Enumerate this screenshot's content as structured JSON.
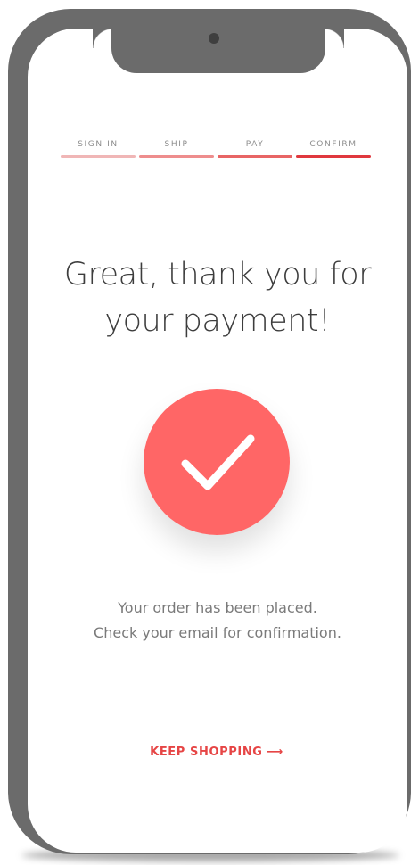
{
  "colors": {
    "accent": "#e64545",
    "check_fill": "#ff6666",
    "step_bars": [
      "#f0b6b6",
      "#ee8d8d",
      "#e86565",
      "#e0383e"
    ]
  },
  "steps": [
    {
      "label": "SIGN IN"
    },
    {
      "label": "SHIP"
    },
    {
      "label": "PAY"
    },
    {
      "label": "CONFIRM"
    }
  ],
  "title": {
    "line1": "Great, thank you for",
    "line2": "your payment!"
  },
  "icon": "checkmark-icon",
  "message": {
    "line1": "Your order has been placed.",
    "line2": "Check your email for confirmation."
  },
  "cta": {
    "label": "KEEP SHOPPING",
    "arrow": "⟶"
  }
}
